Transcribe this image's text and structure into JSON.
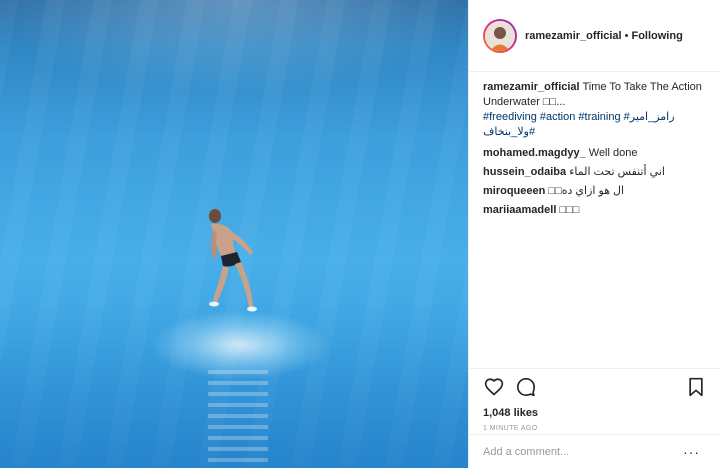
{
  "post": {
    "author": "ramezamir_official",
    "follow_status": "Following",
    "separator": "•",
    "caption_text": " Time To Take The Action Underwater □□...",
    "caption_tags": "#freediving #action #training #رامز_امير #ولا_بنخاف",
    "likes": "1,048 likes",
    "time": "1 MINUTE AGO",
    "comment_placeholder": "Add a comment...",
    "more": "···"
  },
  "comments": [
    {
      "user": "mohamed.magdyy_",
      "text": " Well done"
    },
    {
      "user": "hussein_odaiba",
      "text": "اني أتنفس تحت الماء"
    },
    {
      "user": "miroqueeen",
      "text": "ال هو ازاي ده□□"
    },
    {
      "user": "mariiaamadell",
      "text": "□□□"
    }
  ],
  "icons": {
    "like": "heart-icon",
    "comment": "comment-icon",
    "save": "bookmark-icon"
  },
  "colors": {
    "water": "#3fa6e3",
    "link": "#003569",
    "muted": "#999999",
    "border": "#efefef"
  }
}
